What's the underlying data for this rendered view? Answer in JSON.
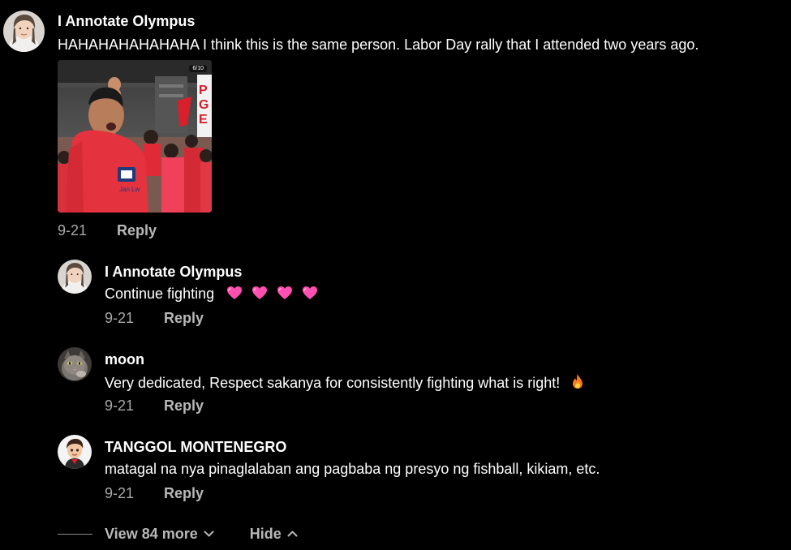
{
  "comments": {
    "main": {
      "username": "I Annotate Olympus",
      "text": "HAHAHAHAHAHAHA I think this is the same person. Labor Day rally that I attended two years ago.",
      "photo_counter": "6/10",
      "date": "9-21",
      "reply_label": "Reply"
    },
    "replies": [
      {
        "username": "I Annotate Olympus",
        "text": "Continue fighting",
        "emoji": "pink-heart-icon",
        "emoji_count": 4,
        "date": "9-21",
        "reply_label": "Reply"
      },
      {
        "username": "moon",
        "text": "Very dedicated, Respect sakanya for consistently fighting what is right!",
        "emoji": "fire-icon",
        "date": "9-21",
        "reply_label": "Reply"
      },
      {
        "username": "TANGGOL MONTENEGRO",
        "text": "matagal na nya pinaglalaban ang pagbaba ng presyo ng fishball, kikiam, etc.",
        "date": "9-21",
        "reply_label": "Reply"
      }
    ]
  },
  "footer": {
    "view_more_label": "View 84 more",
    "hide_label": "Hide"
  },
  "colors": {
    "background": "#000000",
    "text": "#ffffff",
    "muted": "#a8a8a8",
    "heart": "#ff4fb0",
    "flame": "#ff7a1a"
  }
}
